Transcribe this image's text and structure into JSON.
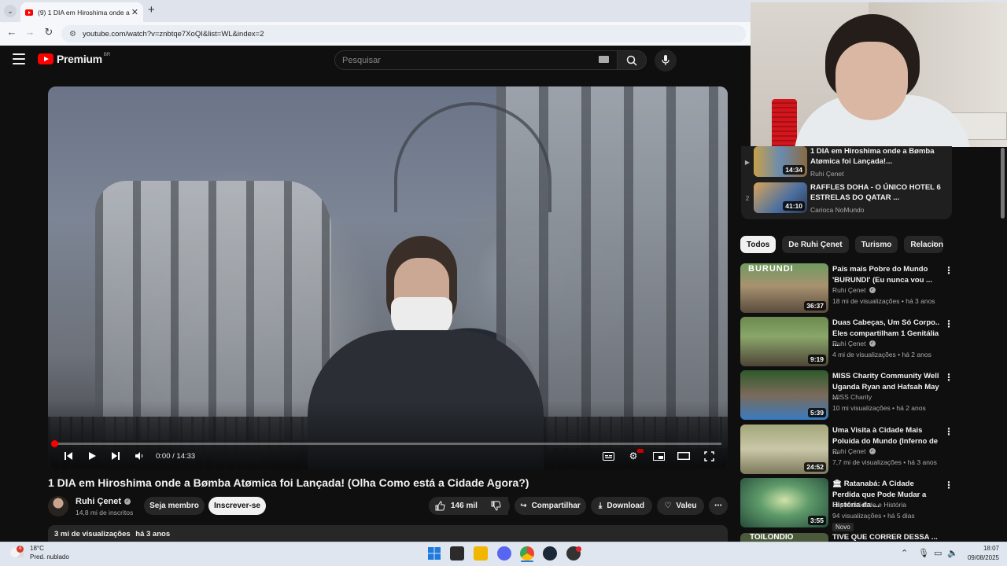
{
  "browser": {
    "tab_title": "(9) 1 DIA em Hiroshima onde a",
    "url": "youtube.com/watch?v=znbtqe7XoQI&list=WL&index=2"
  },
  "header": {
    "logo_text": "Premium",
    "logo_country": "BR",
    "search_placeholder": "Pesquisar"
  },
  "player": {
    "time": "0:00 / 14:33",
    "progress": 0.005
  },
  "video": {
    "title": "1 DIA em Hiroshima onde a Bømba Atømica foi Lançada! (Olha Como está a Cidade Agora?)",
    "channel": "Ruhi Çenet",
    "subscribers": "14,8 mi de inscritos",
    "join_label": "Seja membro",
    "subscribe_label": "Inscrever-se",
    "likes": "146 mil",
    "share_label": "Compartilhar",
    "download_label": "Download",
    "thanks_label": "Valeu",
    "views": "3 mi de visualizações",
    "age": "há 3 anos"
  },
  "playlist": [
    {
      "index": "▶",
      "title": "1 DIA em Hiroshima onde a Bømba Atømica foi Lançada!...",
      "channel": "Ruhi Çenet",
      "duration": "14:34"
    },
    {
      "index": "2",
      "title": "RAFFLES DOHA - O ÚNICO HOTEL 6 ESTRELAS DO QATAR ...",
      "channel": "Carioca NoMundo",
      "duration": "41:10"
    }
  ],
  "chips": [
    "Todos",
    "De Ruhi Çenet",
    "Turismo",
    "Relaciona"
  ],
  "recommendations": [
    {
      "title": "País mais Pobre do Mundo 'BURUNDI' (Eu nunca vou ...",
      "channel": "Ruhi Çenet",
      "verified": true,
      "meta": "18 mi de visualizações • há 3 anos",
      "duration": "36:37",
      "thumb_label": "BURUNDI"
    },
    {
      "title": "Duas Cabeças, Um Só Corpo.. Eles compartilham 1 Genitália ...",
      "channel": "Ruhi Çenet",
      "verified": true,
      "meta": "4 mi de visualizações • há 2 anos",
      "duration": "9:19",
      "thumb_label": ""
    },
    {
      "title": "MISS Charity Community Well Uganda Ryan and Hafsah May ...",
      "channel": "MISS Charity",
      "verified": false,
      "meta": "10 mi visualizações • há 2 anos",
      "duration": "5:39",
      "thumb_label": ""
    },
    {
      "title": "Uma Visita à Cidade Mais Poluída do Mundo (Inferno de ...",
      "channel": "Ruhi Çenet",
      "verified": true,
      "meta": "7,7 mi de visualizações • há 3 anos",
      "duration": "24:52",
      "thumb_label": ""
    },
    {
      "title": "🏛 Ratanabá: A Cidade Perdida que Pode Mudar a História da ...",
      "channel": "Espiritualidade e História",
      "verified": false,
      "meta": "94 visualizações • há 5 dias",
      "duration": "3:55",
      "thumb_label": "",
      "badge": "Novo"
    },
    {
      "title": "TIVE QUE CORRER DESSA ...",
      "channel": "",
      "verified": false,
      "meta": "",
      "duration": "",
      "thumb_label": "TOILONDIO"
    }
  ],
  "taskbar": {
    "temp": "18°C",
    "weather": "Pred. nublado",
    "weather_badge": "4",
    "time": "18:07",
    "date": "09/08/2025"
  },
  "colors": {
    "accent": "#ff0000",
    "bg": "#0f0f0f",
    "surface": "#272727"
  }
}
